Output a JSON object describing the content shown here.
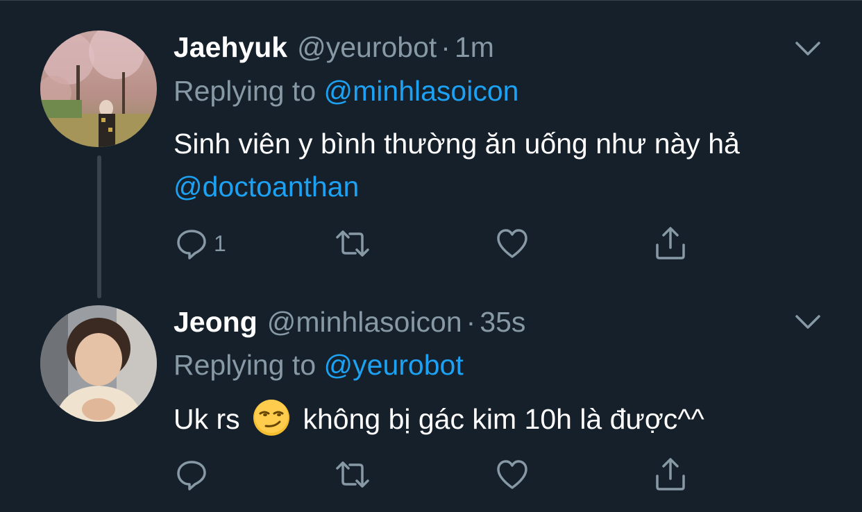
{
  "tweets": [
    {
      "display_name": "Jaehyuk",
      "handle": "@yeurobot",
      "separator": "·",
      "time": "1m",
      "replying_label": "Replying to",
      "replying_to": "@minhlasoicon",
      "text_part1": "Sinh viên y bình thường ăn uống như này hả",
      "text_mention": "@doctoanthan",
      "reply_count": "1",
      "icons": [
        "reply-icon",
        "retweet-icon",
        "like-icon",
        "share-icon",
        "chevron-down-icon"
      ]
    },
    {
      "display_name": "Jeong",
      "handle": "@minhlasoicon",
      "separator": "·",
      "time": "35s",
      "replying_label": "Replying to",
      "replying_to": "@yeurobot",
      "text_part1": "Uk rs",
      "emoji": "smirking-face-emoji",
      "text_part2": "không bị gác kim 10h là được^^",
      "reply_count": "",
      "icons": [
        "reply-icon",
        "retweet-icon",
        "like-icon",
        "share-icon",
        "chevron-down-icon"
      ]
    }
  ],
  "colors": {
    "background": "#15202b",
    "text": "#ffffff",
    "secondary_text": "#8899a6",
    "link": "#1da1f2",
    "divider": "#38444d"
  }
}
